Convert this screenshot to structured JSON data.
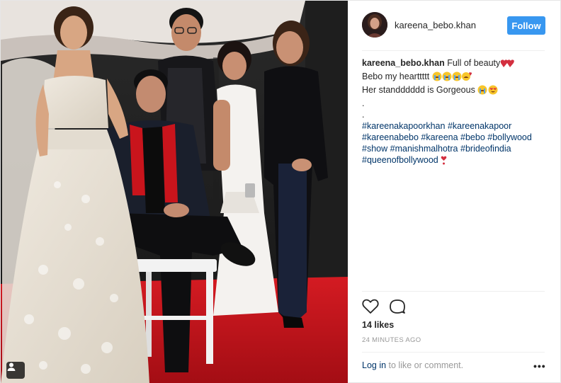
{
  "post": {
    "username": "kareena_bebo.khan",
    "follow_label": "Follow",
    "caption_lines": [
      {
        "text": "Full of beauty"
      },
      {
        "text": "Bebo my hearttttt"
      },
      {
        "text": "Her standddddd is Gorgeous"
      },
      {
        "text": "."
      },
      {
        "text": "."
      }
    ],
    "hashtags": [
      [
        "#kareenakapoorkhan",
        "#kareenakapoor"
      ],
      [
        "#kareenabebo",
        "#kareena",
        "#bebo",
        "#bollywood"
      ],
      [
        "#show",
        "#manishmalhotra",
        "#brideofindia"
      ],
      [
        "#queenofbollywood"
      ]
    ],
    "likes": "14 likes",
    "timestamp": "24 MINUTES AGO",
    "login_link": "Log in",
    "login_suffix": " to like or comment.",
    "more_label": "•••"
  },
  "icons": {
    "heart": "heart-icon",
    "comment": "comment-icon",
    "tag": "user-tag-icon",
    "more": "more-options-icon"
  },
  "colors": {
    "accent": "#3897f0",
    "link": "#003569",
    "muted": "#999999",
    "text": "#262626",
    "carpet": "#c0141c"
  }
}
